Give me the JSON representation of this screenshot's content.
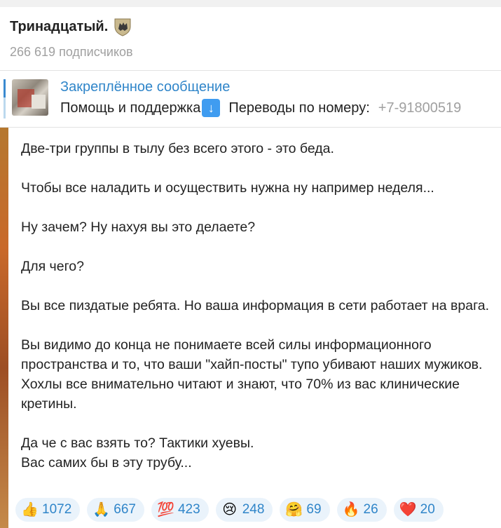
{
  "channel": {
    "title": "Тринадцатый.",
    "subscribers": "266 619 подписчиков",
    "badge_icon": "wolf-shield-icon"
  },
  "pinned": {
    "title": "Закреплённое сообщение",
    "text": "Помощь и поддержка",
    "arrow_icon": "down-arrow-emoji",
    "transfer_label": "Переводы по номеру:",
    "phone": "+7-91800519"
  },
  "message": {
    "paragraphs": [
      "Две-три группы в тылу без всего этого - это беда.",
      "Чтобы все наладить и осуществить нужна ну например неделя...",
      "Ну зачем? Ну нахуя вы это делаете?",
      "Для чего?",
      "Вы все пиздатые ребята. Но ваша информация в сети работает на врага.",
      "Вы видимо до конца не понимаете всей силы информационного пространства и то, что ваши \"хайп-посты\" тупо убивают наших мужиков. Хохлы все внимательно читают и знают, что 70% из вас клинические кретины."
    ],
    "last_line_1": "Да че с вас взять то? Тактики хуевы.",
    "last_line_2": "Вас самих бы в эту трубу..."
  },
  "reactions": [
    {
      "emoji": "👍",
      "icon": "thumbs-up-emoji",
      "count": "1072"
    },
    {
      "emoji": "🙏",
      "icon": "pray-emoji",
      "count": "667"
    },
    {
      "emoji": "💯",
      "icon": "hundred-emoji",
      "count": "423"
    },
    {
      "emoji": "😢",
      "icon": "crying-emoji",
      "count": "248"
    },
    {
      "emoji": "🤗",
      "icon": "hug-emoji",
      "count": "69"
    },
    {
      "emoji": "🔥",
      "icon": "fire-emoji",
      "count": "26"
    },
    {
      "emoji": "❤️",
      "icon": "heart-emoji",
      "count": "20"
    }
  ],
  "colors": {
    "accent": "#2f85c9",
    "reaction_bg": "#eaf3fb",
    "muted": "#a0a0a0"
  }
}
